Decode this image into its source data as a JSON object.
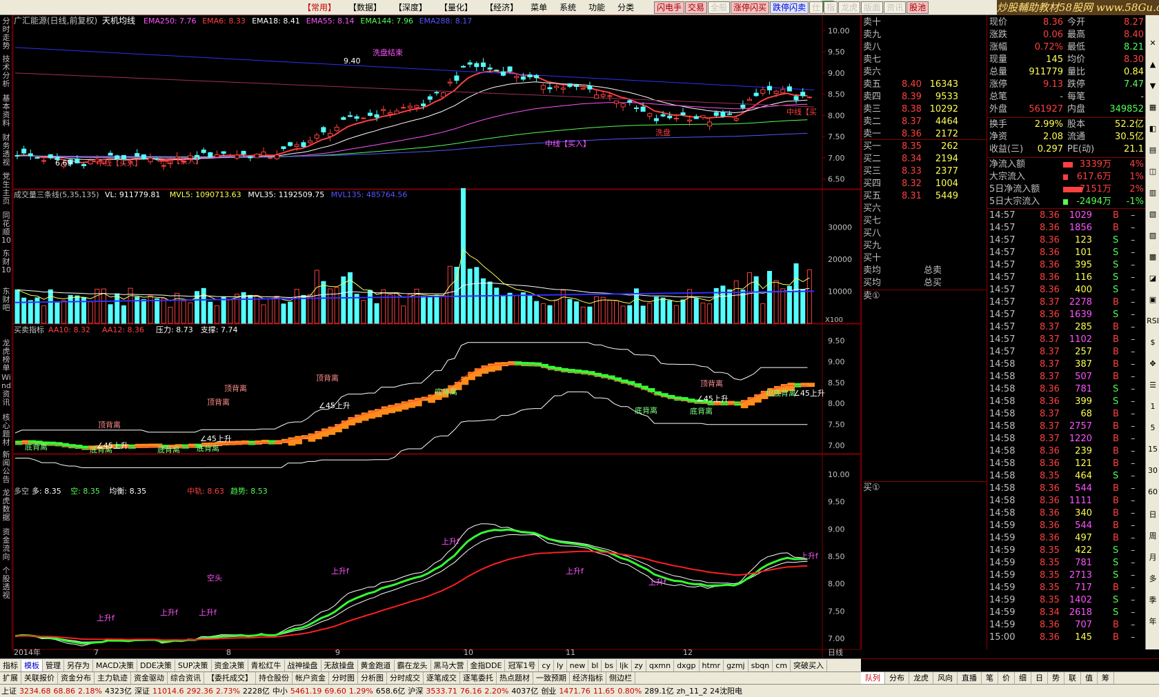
{
  "app_title": "炒股辅助教材58股网",
  "watermark": "炒股輔助教材58股网  www.58Gu.com",
  "top_menu": [
    {
      "label": "【常用】",
      "active": true
    },
    {
      "label": "【数据】",
      "active": false
    },
    {
      "label": "【深度】",
      "active": false
    },
    {
      "label": "【量化】",
      "active": false
    },
    {
      "label": "【经济】",
      "active": false
    },
    {
      "label": "菜单",
      "active": false
    },
    {
      "label": "系统",
      "active": false
    },
    {
      "label": "功能",
      "active": false
    },
    {
      "label": "分类",
      "active": false
    }
  ],
  "quick_buttons": [
    {
      "label": "闪电手",
      "style": "red"
    },
    {
      "label": "交易",
      "style": "red"
    },
    {
      "label": "全般",
      "style": "plain"
    },
    {
      "label": "涨停闪买",
      "style": "red"
    },
    {
      "label": "跌停闪卖",
      "style": "blue"
    },
    {
      "label": "仕",
      "style": "plain"
    },
    {
      "label": "指",
      "style": "plain"
    },
    {
      "label": "龙虎",
      "style": "plain"
    },
    {
      "label": "版面",
      "style": "plain"
    },
    {
      "label": "资讯",
      "style": "plain"
    },
    {
      "label": "股池",
      "style": "red"
    }
  ],
  "badge": "60",
  "left_tabs": [
    "分时走势",
    "技术分析",
    "基本资料",
    "财务透视",
    "党生主页",
    "同花顺10",
    "东财10",
    "东财吧",
    "龙虎榜单",
    "Wind资讯",
    "核心题材",
    "新闻公告",
    "龙虎数据",
    "资金流向",
    "个股透视"
  ],
  "main_chart": {
    "title": "广汇能源(日线,前复权)",
    "indicator": "天机均线",
    "legend": [
      {
        "label": "EMA250: 7.76",
        "color": "#ff54ff"
      },
      {
        "label": "EMA6: 8.33",
        "color": "#ff4040"
      },
      {
        "label": "EMA18: 8.41",
        "color": "#ffffff"
      },
      {
        "label": "EMA55: 8.14",
        "color": "#ff54ff"
      },
      {
        "label": "EMA144: 7.96",
        "color": "#54ff54"
      },
      {
        "label": "EMA288: 8.17",
        "color": "#5454ff"
      }
    ],
    "y_ticks": [
      "10.00",
      "9.50",
      "9.00",
      "8.50",
      "8.00",
      "7.50",
      "7.00",
      "6.50"
    ],
    "annotations": [
      "9.40",
      "6.69",
      "中线【买入】",
      "中线【买入】",
      "中线【买入】",
      "洗盘结束",
      "洗盘",
      "中线【买"
    ],
    "x_labels": [
      "2014年",
      "7",
      "8",
      "9",
      "10",
      "11",
      "12"
    ],
    "period": "日线"
  },
  "volume_chart": {
    "title": "成交量三条线(5,35,135)",
    "legend": [
      {
        "label": "VL: 911779.81",
        "color": "#ffffff"
      },
      {
        "label": "MVL5: 1090713.63",
        "color": "#ffff54"
      },
      {
        "label": "MVL35: 1192509.75",
        "color": "#ffffff"
      },
      {
        "label": "MVL135: 485764.56",
        "color": "#5454ff"
      }
    ],
    "y_ticks": [
      "30000",
      "20000",
      "10000"
    ],
    "unit": "X100"
  },
  "signal_chart": {
    "title": "买卖指标",
    "legend": [
      {
        "label": "AA10: 8.32",
        "color": "#ff4040"
      },
      {
        "label": "AA12: 8.36",
        "color": "#ff4040"
      },
      {
        "label": "压力: 8.73",
        "color": "#ffffff"
      },
      {
        "label": "支撑: 7.74",
        "color": "#ffffff"
      }
    ],
    "y_ticks": [
      "9.50",
      "9.00",
      "8.50",
      "8.00",
      "7.50",
      "7.00"
    ],
    "annotations": [
      "顶背离",
      "顶背离",
      "顶背离",
      "顶背离",
      "顶背离",
      "底背离",
      "底背离",
      "底背离",
      "底背离",
      "底背离",
      "底背离",
      "底背离",
      "∠45上升",
      "∠45上升",
      "∠45上升",
      "∠45上升",
      "∠45上升",
      "坦底背离"
    ]
  },
  "trend_chart": {
    "title": "多空",
    "legend": [
      {
        "label": "多: 8.35",
        "color": "#ffffff"
      },
      {
        "label": "空: 8.35",
        "color": "#54ff54"
      },
      {
        "label": "均衡: 8.35",
        "color": "#ffffff"
      },
      {
        "label": "中轨: 8.63",
        "color": "#ff4040"
      },
      {
        "label": "趋势: 8.53",
        "color": "#54ff54"
      }
    ],
    "y_ticks": [
      "10.00",
      "9.50",
      "9.00",
      "8.50",
      "8.00",
      "7.50",
      "7.00"
    ],
    "annotations": [
      "上升f",
      "上升f",
      "上升f",
      "上升f",
      "上升f",
      "空头",
      "上升f",
      "上升f",
      "上升f"
    ]
  },
  "orderbook": {
    "sells": [
      {
        "label": "卖十",
        "price": "",
        "vol": ""
      },
      {
        "label": "卖九",
        "price": "",
        "vol": ""
      },
      {
        "label": "卖八",
        "price": "",
        "vol": ""
      },
      {
        "label": "卖七",
        "price": "",
        "vol": ""
      },
      {
        "label": "卖六",
        "price": "",
        "vol": ""
      },
      {
        "label": "卖五",
        "price": "8.40",
        "vol": "16343"
      },
      {
        "label": "卖四",
        "price": "8.39",
        "vol": "9533"
      },
      {
        "label": "卖三",
        "price": "8.38",
        "vol": "10292"
      },
      {
        "label": "卖二",
        "price": "8.37",
        "vol": "4464"
      },
      {
        "label": "卖一",
        "price": "8.36",
        "vol": "2172"
      }
    ],
    "buys": [
      {
        "label": "买一",
        "price": "8.35",
        "vol": "262"
      },
      {
        "label": "买二",
        "price": "8.34",
        "vol": "2194"
      },
      {
        "label": "买三",
        "price": "8.33",
        "vol": "2377"
      },
      {
        "label": "买四",
        "price": "8.32",
        "vol": "1004"
      },
      {
        "label": "买五",
        "price": "8.31",
        "vol": "5449"
      },
      {
        "label": "买六",
        "price": "",
        "vol": ""
      },
      {
        "label": "买七",
        "price": "",
        "vol": ""
      },
      {
        "label": "买八",
        "price": "",
        "vol": ""
      },
      {
        "label": "买九",
        "price": "",
        "vol": ""
      },
      {
        "label": "买十",
        "price": "",
        "vol": ""
      }
    ],
    "sell_avg": "卖均",
    "buy_avg": "买均",
    "total_sell": "总卖",
    "total_buy": "总买",
    "sell_one": "卖①",
    "buy_one": "买①"
  },
  "info": {
    "rows": [
      {
        "l1": "现价",
        "v1": "8.36",
        "c1": "#ff4040",
        "l2": "今开",
        "v2": "8.27",
        "c2": "#ff4040"
      },
      {
        "l1": "涨跌",
        "v1": "0.06",
        "c1": "#ff4040",
        "l2": "最高",
        "v2": "8.40",
        "c2": "#ff4040"
      },
      {
        "l1": "涨幅",
        "v1": "0.72%",
        "c1": "#ff4040",
        "l2": "最低",
        "v2": "8.21",
        "c2": "#54ff54"
      },
      {
        "l1": "现量",
        "v1": "145",
        "c1": "#ffff54",
        "l2": "均价",
        "v2": "8.30",
        "c2": "#ff4040"
      },
      {
        "l1": "总量",
        "v1": "911779",
        "c1": "#ffff54",
        "l2": "量比",
        "v2": "0.84",
        "c2": "#ffff54"
      },
      {
        "l1": "涨停",
        "v1": "9.13",
        "c1": "#ff4040",
        "l2": "跌停",
        "v2": "7.47",
        "c2": "#54ff54"
      },
      {
        "l1": "总笔",
        "v1": "-",
        "c1": "#c0c0c0",
        "l2": "每笔",
        "v2": "-",
        "c2": "#c0c0c0"
      },
      {
        "l1": "外盘",
        "v1": "561927",
        "c1": "#ff4040",
        "l2": "内盘",
        "v2": "349852",
        "c2": "#54ff54"
      },
      {
        "l1": "换手",
        "v1": "2.99%",
        "c1": "#ffff54",
        "l2": "股本",
        "v2": "52.2亿",
        "c2": "#ffff54"
      },
      {
        "l1": "净资",
        "v1": "2.08",
        "c1": "#ffff54",
        "l2": "流通",
        "v2": "30.5亿",
        "c2": "#ffff54"
      },
      {
        "l1": "收益(三)",
        "v1": "0.297",
        "c1": "#ffff54",
        "l2": "PE(动)",
        "v2": "21.1",
        "c2": "#ffff54"
      }
    ],
    "flows": [
      {
        "label": "净流入额",
        "value": "3339万",
        "pct": "4%",
        "bar": 0.25,
        "color": "#ff4040"
      },
      {
        "label": "大宗流入",
        "value": "617.6万",
        "pct": "1%",
        "bar": 0.08,
        "color": "#ff4040"
      },
      {
        "label": "5日净流入额",
        "value": "7151万",
        "pct": "2%",
        "bar": 0.6,
        "color": "#ff4040"
      },
      {
        "label": "5日大宗流入",
        "value": "-2494万",
        "pct": "-1%",
        "bar": 0.08,
        "color": "#54ff54"
      }
    ],
    "ticks": [
      {
        "t": "14:57",
        "p": "8.36",
        "v": "1029",
        "d": "B"
      },
      {
        "t": "14:57",
        "p": "8.36",
        "v": "1856",
        "d": "B"
      },
      {
        "t": "14:57",
        "p": "8.36",
        "v": "123",
        "d": "S"
      },
      {
        "t": "14:57",
        "p": "8.36",
        "v": "101",
        "d": "S"
      },
      {
        "t": "14:57",
        "p": "8.36",
        "v": "395",
        "d": "S"
      },
      {
        "t": "14:57",
        "p": "8.36",
        "v": "116",
        "d": "S"
      },
      {
        "t": "14:57",
        "p": "8.36",
        "v": "400",
        "d": "S"
      },
      {
        "t": "14:57",
        "p": "8.37",
        "v": "2278",
        "d": "B"
      },
      {
        "t": "14:57",
        "p": "8.36",
        "v": "1639",
        "d": "S"
      },
      {
        "t": "14:57",
        "p": "8.37",
        "v": "285",
        "d": "B"
      },
      {
        "t": "14:57",
        "p": "8.37",
        "v": "1102",
        "d": "B"
      },
      {
        "t": "14:57",
        "p": "8.37",
        "v": "257",
        "d": "B"
      },
      {
        "t": "14:58",
        "p": "8.37",
        "v": "387",
        "d": "B"
      },
      {
        "t": "14:58",
        "p": "8.37",
        "v": "507",
        "d": "B"
      },
      {
        "t": "14:58",
        "p": "8.36",
        "v": "781",
        "d": "S"
      },
      {
        "t": "14:58",
        "p": "8.36",
        "v": "399",
        "d": "S"
      },
      {
        "t": "14:58",
        "p": "8.37",
        "v": "68",
        "d": "B"
      },
      {
        "t": "14:58",
        "p": "8.37",
        "v": "2757",
        "d": "B"
      },
      {
        "t": "14:58",
        "p": "8.37",
        "v": "1220",
        "d": "B"
      },
      {
        "t": "14:58",
        "p": "8.36",
        "v": "239",
        "d": "B"
      },
      {
        "t": "14:58",
        "p": "8.36",
        "v": "121",
        "d": "B"
      },
      {
        "t": "14:58",
        "p": "8.35",
        "v": "464",
        "d": "S"
      },
      {
        "t": "14:58",
        "p": "8.36",
        "v": "544",
        "d": "B"
      },
      {
        "t": "14:58",
        "p": "8.36",
        "v": "1111",
        "d": "B"
      },
      {
        "t": "14:58",
        "p": "8.36",
        "v": "340",
        "d": "B"
      },
      {
        "t": "14:59",
        "p": "8.36",
        "v": "544",
        "d": "B"
      },
      {
        "t": "14:59",
        "p": "8.36",
        "v": "497",
        "d": "B"
      },
      {
        "t": "14:59",
        "p": "8.35",
        "v": "422",
        "d": "S"
      },
      {
        "t": "14:59",
        "p": "8.35",
        "v": "781",
        "d": "S"
      },
      {
        "t": "14:59",
        "p": "8.35",
        "v": "2713",
        "d": "S"
      },
      {
        "t": "14:59",
        "p": "8.35",
        "v": "717",
        "d": "B"
      },
      {
        "t": "14:59",
        "p": "8.35",
        "v": "1402",
        "d": "S"
      },
      {
        "t": "14:59",
        "p": "8.34",
        "v": "2618",
        "d": "S"
      },
      {
        "t": "14:59",
        "p": "8.36",
        "v": "707",
        "d": "B"
      },
      {
        "t": "15:00",
        "p": "8.36",
        "v": "145",
        "d": "B"
      }
    ]
  },
  "right_icons": [
    "✕",
    "▲",
    "▼",
    "▦",
    "◧",
    "▤",
    "◫",
    "▥",
    "▧",
    "▨",
    "▩",
    "◪",
    "▣",
    "RSI",
    "$",
    "✥",
    "☰",
    "1",
    "5",
    "15",
    "30",
    "60",
    "日",
    "周",
    "月",
    "多",
    "季",
    "年"
  ],
  "bottom_tabs1": [
    "指标",
    "模板",
    "管理",
    "另存为",
    "MACD决策",
    "DDE决策",
    "SUP决策",
    "资金决策",
    "青松红牛",
    "战神操盘",
    "无敌操盘",
    "黄金跑道",
    "霸在龙头",
    "黑马大营",
    "金指DDE",
    "冠军1号",
    "cy",
    "ly",
    "new",
    "bl",
    "bs",
    "ljk",
    "zy",
    "qxmn",
    "dxgp",
    "htmr",
    "gzmj",
    "sbqn",
    "cm",
    "突破买入"
  ],
  "bottom_tabs2": [
    "扩展",
    "关联报价",
    "资金分布",
    "主力轨迹",
    "资金驱动",
    "综合资讯",
    "【委托成交】",
    "持仓股份",
    "帐户资金",
    "分时图",
    "分析图",
    "分时成交",
    "逐笔成交",
    "逐笔委托",
    "热点题材",
    "一致预期",
    "经济指标",
    "侧边栏"
  ],
  "right_bottom_tabs": [
    "队列",
    "分布",
    "龙虎",
    "风向",
    "直播",
    "笔",
    "价",
    "细",
    "日",
    "势",
    "联",
    "值",
    "筹"
  ],
  "status": [
    {
      "label": "上证",
      "cls": ""
    },
    {
      "label": "3234.68",
      "cls": "up"
    },
    {
      "label": "68.86",
      "cls": "up"
    },
    {
      "label": "2.18%",
      "cls": "up"
    },
    {
      "label": "4323亿",
      "cls": ""
    },
    {
      "label": "深证",
      "cls": ""
    },
    {
      "label": "11014.6",
      "cls": "up"
    },
    {
      "label": "292.36",
      "cls": "up"
    },
    {
      "label": "2.73%",
      "cls": "up"
    },
    {
      "label": "2228亿",
      "cls": ""
    },
    {
      "label": "中小",
      "cls": ""
    },
    {
      "label": "5461.19",
      "cls": "up"
    },
    {
      "label": "69.60",
      "cls": "up"
    },
    {
      "label": "1.29%",
      "cls": "up"
    },
    {
      "label": "658.6亿",
      "cls": ""
    },
    {
      "label": "沪深",
      "cls": ""
    },
    {
      "label": "3533.71",
      "cls": "up"
    },
    {
      "label": "76.16",
      "cls": "up"
    },
    {
      "label": "2.20%",
      "cls": "up"
    },
    {
      "label": "4037亿",
      "cls": ""
    },
    {
      "label": "创业",
      "cls": ""
    },
    {
      "label": "1471.76",
      "cls": "up"
    },
    {
      "label": "11.65",
      "cls": "up"
    },
    {
      "label": "0.80%",
      "cls": "up"
    },
    {
      "label": "289.1亿",
      "cls": ""
    },
    {
      "label": "zh_11_2 24沈阳电",
      "cls": ""
    }
  ],
  "colors": {
    "up": "#ff4040",
    "down": "#54ff54",
    "volume": "#ffff54",
    "grid": "#800000",
    "bg": "#000000"
  }
}
